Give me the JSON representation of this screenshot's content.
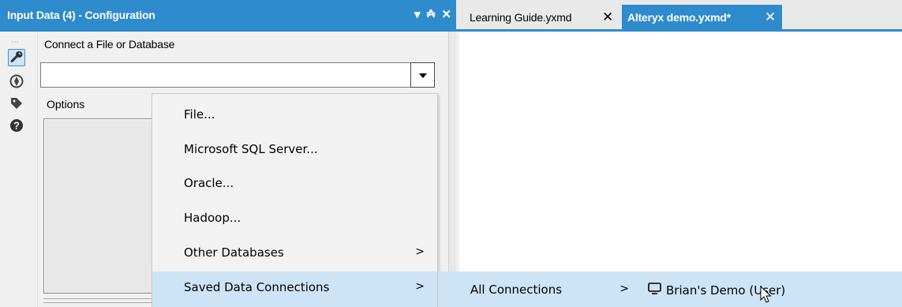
{
  "config_panel": {
    "title": "Input Data (4) - Configuration",
    "controls": {
      "menu": "▾",
      "pin": "₳",
      "close": "✕"
    },
    "icons": [
      "wrench-icon",
      "target-icon",
      "tag-icon",
      "help-icon"
    ],
    "connect_label": "Connect a File or Database",
    "connect_value": "",
    "options_label": "Options"
  },
  "tabs": [
    {
      "label": "Learning Guide.yxmd",
      "close": "✕",
      "active": false
    },
    {
      "label": "Alteryx demo.yxmd*",
      "close": "✕",
      "active": true
    }
  ],
  "menu": {
    "items": [
      {
        "label": "File...",
        "arrow": ""
      },
      {
        "label": "Microsoft SQL Server...",
        "arrow": ""
      },
      {
        "label": "Oracle...",
        "arrow": ""
      },
      {
        "label": "Hadoop...",
        "arrow": ""
      },
      {
        "label": "Other Databases",
        "arrow": ">"
      },
      {
        "label": "Saved Data Connections",
        "arrow": ">"
      }
    ]
  },
  "submenu": {
    "label": "All Connections",
    "arrow": ">"
  },
  "submenu2": {
    "label": "Brian's Demo (User)"
  },
  "colors": {
    "accent": "#2e8bcc",
    "highlight": "#cde4f6"
  }
}
